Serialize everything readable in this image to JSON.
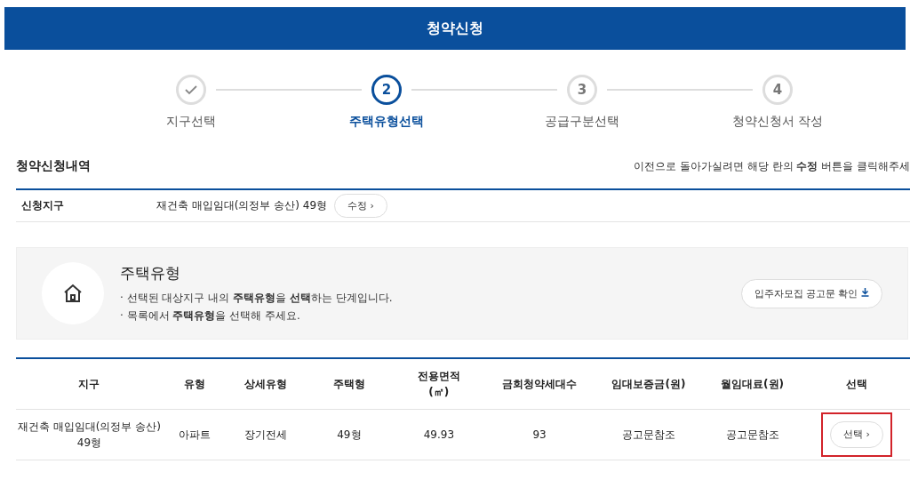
{
  "header": {
    "title": "청약신청"
  },
  "steps": [
    {
      "label": "지구선택",
      "done": true,
      "selected": false
    },
    {
      "number": "2",
      "label": "주택유형선택",
      "done": false,
      "selected": true
    },
    {
      "number": "3",
      "label": "공급구분선택",
      "done": false,
      "selected": false
    },
    {
      "number": "4",
      "label": "청약신청서 작성",
      "done": false,
      "selected": false
    }
  ],
  "summary": {
    "title": "청약신청내역",
    "notice": "이전으로 돌아가실려면 해당 란의 **수정** 버튼을 클릭해주세",
    "rows": [
      {
        "label": "신청지구",
        "value": "재건축 매입임대(의정부 송산) 49형",
        "button": "수정 ›"
      }
    ]
  },
  "info": {
    "title": "주택유형",
    "lines": [
      "· 선택된 대상지구 내의 **주택유형**을 **선택**하는 단계입니다.",
      "· 목록에서 **주택유형**을 선택해 주세요."
    ],
    "button": "입주자모집 공고문 확인"
  },
  "table": {
    "columns": [
      "지구",
      "유형",
      "상세유형",
      "주택형",
      "전용면적\n(㎡)",
      "금회청약세대수",
      "임대보증금(원)",
      "월임대료(원)",
      "선택"
    ],
    "rows": [
      {
        "cells": [
          "재건축 매입임대(의정부 송산) 49형",
          "아파트",
          "장기전세",
          "49형",
          "49.93",
          "93",
          "공고문참조",
          "공고문참조"
        ],
        "button": "선택 ›",
        "highlighted": true
      }
    ]
  }
}
